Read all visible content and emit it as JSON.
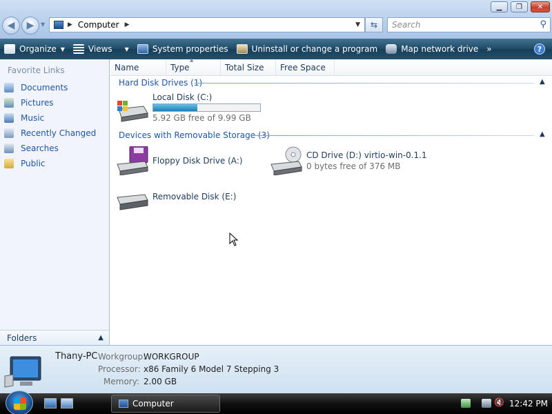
{
  "window": {
    "minimize": "▁",
    "maximize": "❐",
    "close": "✕"
  },
  "address": {
    "path": "Computer",
    "search_placeholder": "Search"
  },
  "toolbar": {
    "organize": "Organize",
    "views": "Views",
    "system_properties": "System properties",
    "uninstall": "Uninstall or change a program",
    "map_drive": "Map network drive",
    "more": "»",
    "help": "?"
  },
  "nav": {
    "header": "Favorite Links",
    "links": [
      "Documents",
      "Pictures",
      "Music",
      "Recently Changed",
      "Searches",
      "Public"
    ],
    "folders": "Folders"
  },
  "columns": [
    "Name",
    "Type",
    "Total Size",
    "Free Space"
  ],
  "groups": {
    "hdd": {
      "title": "Hard Disk Drives (1)"
    },
    "removable": {
      "title": "Devices with Removable Storage (3)"
    }
  },
  "drives": {
    "c": {
      "name": "Local Disk (C:)",
      "sub": "5.92 GB free of 9.99 GB",
      "used_fraction": 0.41
    },
    "a": {
      "name": "Floppy Disk Drive (A:)"
    },
    "d": {
      "name": "CD Drive (D:) virtio-win-0.1.1",
      "sub": "0 bytes free of 376 MB"
    },
    "e": {
      "name": "Removable Disk (E:)"
    }
  },
  "details": {
    "pc_name": "Thany-PC",
    "workgroup_label": "Workgroup:",
    "workgroup": "WORKGROUP",
    "processor_label": "Processor:",
    "processor": "x86 Family 6 Model 7 Stepping 3",
    "memory_label": "Memory:",
    "memory": "2.00 GB"
  },
  "taskbar": {
    "task": "Computer",
    "clock": "12:42 PM"
  },
  "colors": {
    "accent": "#1e55a8",
    "bar_fill": "#2a8fc4"
  }
}
